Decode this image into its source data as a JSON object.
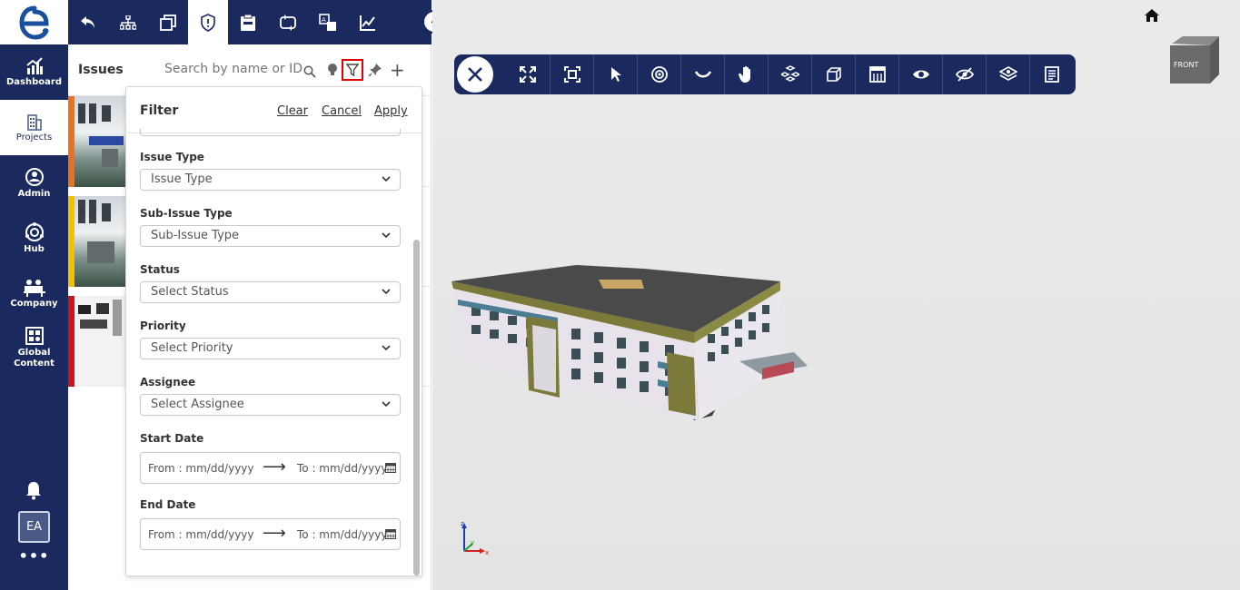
{
  "nav": {
    "items": [
      {
        "label": "Dashboard",
        "icon": "chart-icon"
      },
      {
        "label": "Projects",
        "icon": "building-icon"
      },
      {
        "label": "Admin",
        "icon": "admin-icon"
      },
      {
        "label": "Hub",
        "icon": "hub-icon"
      },
      {
        "label": "Company",
        "icon": "company-icon"
      },
      {
        "label": "Global Content",
        "icon": "global-content-icon"
      }
    ],
    "avatar": "EA",
    "more": "•••"
  },
  "issues": {
    "title": "Issues",
    "search_placeholder": "Search by name or ID",
    "cards": [
      {
        "color": "#e8731a"
      },
      {
        "color": "#f2c200"
      },
      {
        "color": "#d0121b"
      }
    ]
  },
  "filter": {
    "title": "Filter",
    "clear": "Clear",
    "cancel": "Cancel",
    "apply": "Apply",
    "fields": [
      {
        "label": "Issue Type",
        "value": "Issue Type"
      },
      {
        "label": "Sub-Issue Type",
        "value": "Sub-Issue Type"
      },
      {
        "label": "Status",
        "value": "Select Status"
      },
      {
        "label": "Priority",
        "value": "Select Priority"
      },
      {
        "label": "Assignee",
        "value": "Select Assignee"
      }
    ],
    "start_date": {
      "label": "Start Date",
      "from": "From :  mm/dd/yyyy",
      "arrow": "⟶",
      "to": "To :  mm/dd/yyyy"
    },
    "end_date": {
      "label": "End Date",
      "from": "From :  mm/dd/yyyy",
      "arrow": "⟶",
      "to": "To :  mm/dd/yyyy"
    }
  },
  "viewer": {
    "viewcube_label": "FRONT",
    "axis": {
      "z": "z",
      "y": "y",
      "x": "x"
    }
  }
}
